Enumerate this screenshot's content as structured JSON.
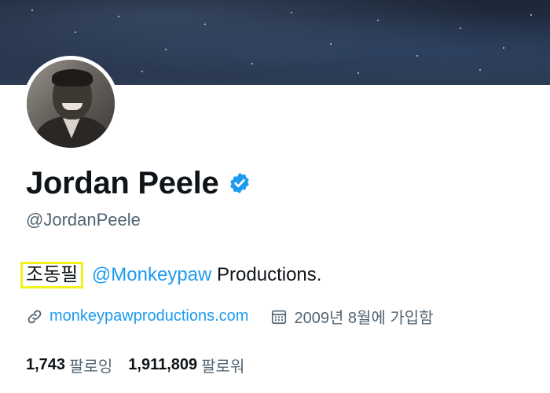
{
  "profile": {
    "display_name": "Jordan Peele",
    "handle": "@JordanPeele",
    "verified": true,
    "bio": {
      "highlighted_text": "조동필",
      "mention": "@Monkeypaw",
      "rest": " Productions."
    },
    "website": "monkeypawproductions.com",
    "joined": "2009년 8월에 가입함",
    "following_count": "1,743",
    "following_label": "팔로잉",
    "followers_count": "1,911,809",
    "followers_label": "팔로워"
  },
  "icons": {
    "verified": "verified-badge-icon",
    "website": "link-icon",
    "joined": "calendar-icon"
  },
  "colors": {
    "accent": "#1d9bf0",
    "secondary_text": "#536471",
    "highlight_box": "#f2f21c"
  }
}
